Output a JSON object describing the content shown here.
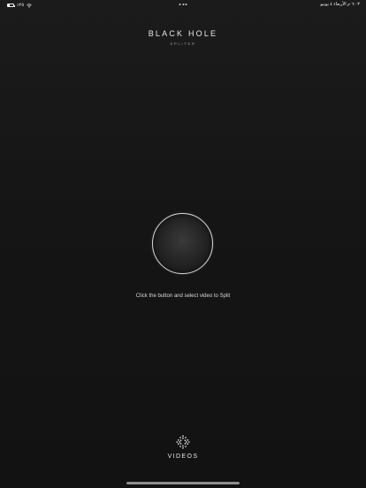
{
  "status_bar": {
    "battery_label": "٪۲٥",
    "battery_level": 0.25,
    "right_text": "٦:٠٣ م  الأربعاء ٤ يونيو"
  },
  "header": {
    "title": "BLACK HOLE",
    "subtitle": "SPLITER"
  },
  "main": {
    "instruction": "Click the button and select video to Split"
  },
  "tab": {
    "videos_label": "VIDEOS"
  }
}
